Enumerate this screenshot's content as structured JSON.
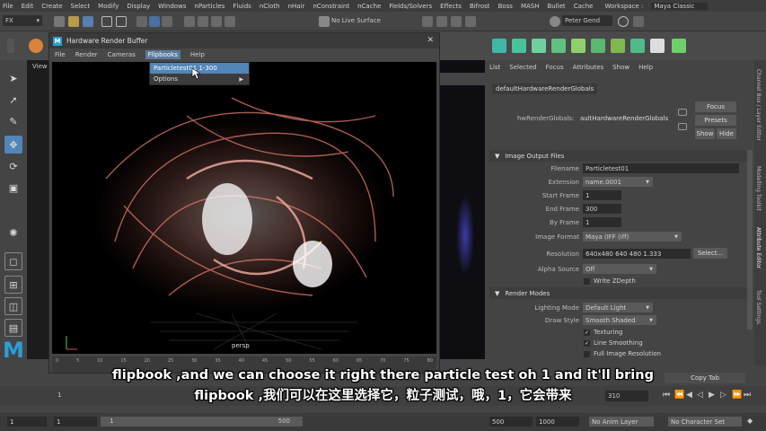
{
  "menubar": {
    "items": [
      "File",
      "Edit",
      "Create",
      "Select",
      "Modify",
      "Display",
      "Windows",
      "nParticles",
      "Fluids",
      "nCloth",
      "nHair",
      "nConstraint",
      "nCache",
      "Fields/Solvers",
      "Effects",
      "Bifrost",
      "Boss",
      "MASH",
      "Bullet",
      "Cache"
    ],
    "workspace_label": "Workspace :",
    "workspace_value": "Maya Classic"
  },
  "shelf": {
    "mode_value": "FX",
    "live_surface": "No Live Surface",
    "user": "Peter Gend"
  },
  "viewport": {
    "tab_label": "View",
    "camera": "persp"
  },
  "render_window": {
    "title": "Hardware Render Buffer",
    "menu": [
      "File",
      "Render",
      "Cameras",
      "Flipbooks",
      "Help"
    ],
    "flipbook_menu": {
      "item1": "Particletest01 1-300",
      "item2": "Options"
    },
    "timeline_ticks": [
      "0",
      "5",
      "10",
      "15",
      "20",
      "25",
      "30",
      "35",
      "40",
      "45",
      "50",
      "55",
      "60",
      "65",
      "70",
      "75",
      "80"
    ]
  },
  "attribute_editor": {
    "menu": [
      "List",
      "Selected",
      "Focus",
      "Attributes",
      "Show",
      "Help"
    ],
    "node_tab": "defaultHardwareRenderGlobals",
    "node_label": "hwRenderGlobals:",
    "node_value": "aultHardwareRenderGlobals",
    "focus_btn": "Focus",
    "presets_btn": "Presets",
    "show_btn": "Show",
    "hide_btn": "Hide",
    "section_image_output": "Image Output Files",
    "filename_label": "Filename",
    "filename_value": "Particletest01",
    "extension_label": "Extension",
    "extension_value": "name.0001",
    "start_frame_label": "Start Frame",
    "start_frame_value": "1",
    "end_frame_label": "End Frame",
    "end_frame_value": "300",
    "by_frame_label": "By Frame",
    "by_frame_value": "1",
    "image_format_label": "Image Format",
    "image_format_value": "Maya (IFF (iff)",
    "resolution_label": "Resolution",
    "resolution_value": "640x480 640 480 1.333",
    "resolution_btn": "Select...",
    "alpha_source_label": "Alpha Source",
    "alpha_source_value": "Off",
    "write_zdepth": "Write ZDepth",
    "section_render_modes": "Render Modes",
    "lighting_mode_label": "Lighting Mode",
    "lighting_mode_value": "Default Light",
    "draw_style_label": "Draw Style",
    "draw_style_value": "Smooth Shaded",
    "texturing": "Texturing",
    "line_smoothing": "Line Smoothing",
    "full_image_resolution": "Full Image Resolution",
    "copy_tab_btn": "Copy Tab"
  },
  "side_tabs": [
    "Channel Box / Layer Editor",
    "Modelling Toolkit",
    "Attribute Editor",
    "Tool Settings"
  ],
  "timebar": {
    "current_frame": "310",
    "start": "1",
    "start2": "1",
    "range_start_box": "1",
    "range_end_box": "500",
    "end": "500",
    "end2": "1000",
    "anim_layer": "No Anim Layer",
    "char_set": "No Character Set"
  },
  "subtitles": {
    "line1": "flipbook ,and we can choose it right there particle test oh 1 and it'll bring",
    "line2": "flipbook ,我们可以在这里选择它，粒子测试，哦，1，它会带来"
  },
  "colors": {
    "accent": "#5285b8",
    "maya_logo": "#2a9fd6",
    "particles": "#e07a6a"
  }
}
